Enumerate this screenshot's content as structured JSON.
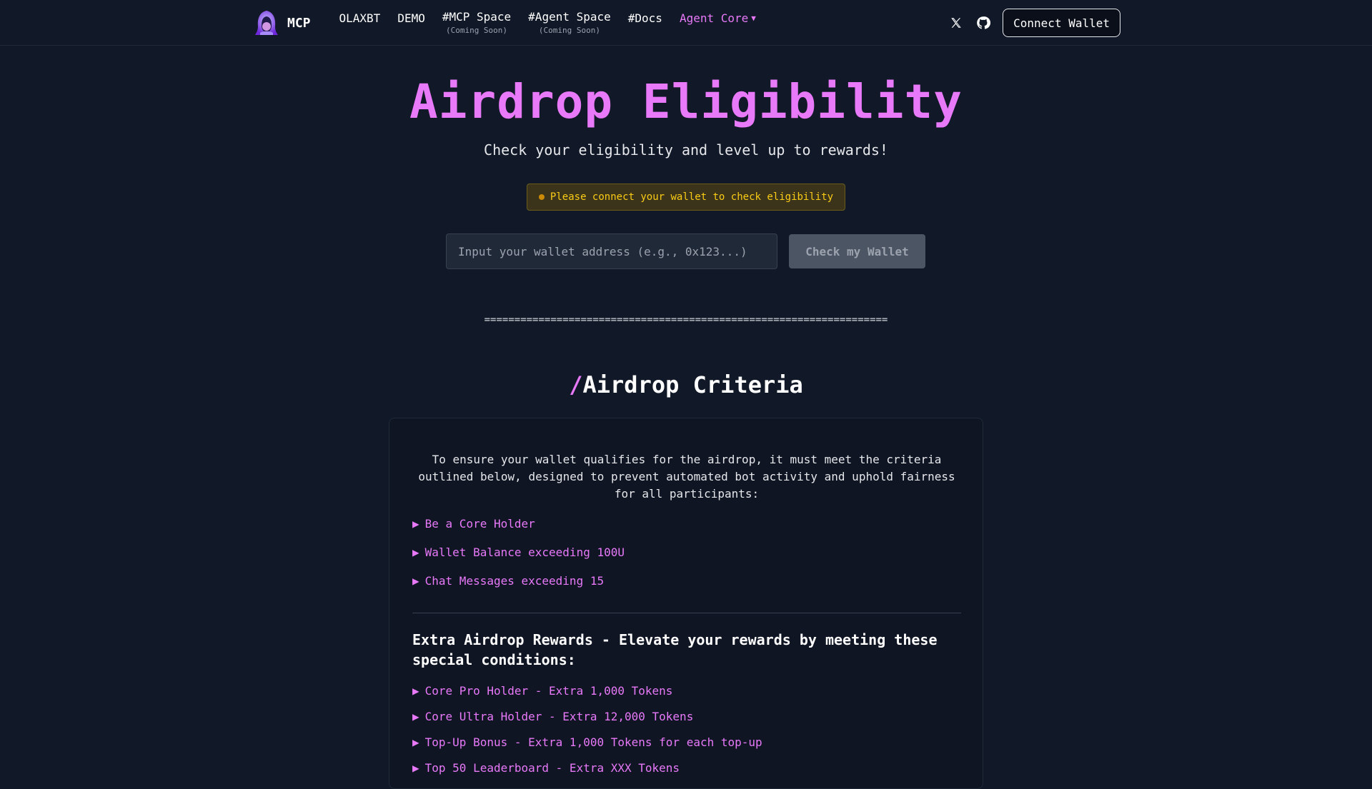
{
  "nav": {
    "brand": "MCP",
    "links": [
      {
        "label": "OLAXBT",
        "sub": ""
      },
      {
        "label": "DEMO",
        "sub": ""
      },
      {
        "label": "#MCP Space",
        "sub": "(Coming Soon)"
      },
      {
        "label": "#Agent Space",
        "sub": "(Coming Soon)"
      },
      {
        "label": "#Docs",
        "sub": ""
      }
    ],
    "dropdown_label": "Agent Core",
    "caret": "▼",
    "x_icon": "x-icon",
    "github_icon": "github-icon",
    "connect_label": "Connect Wallet"
  },
  "hero": {
    "title": "Airdrop Eligibility",
    "subtitle": "Check your eligibility and level up to rewards!",
    "notice": "Please connect your wallet to check eligibility",
    "input_placeholder": "Input your wallet address (e.g., 0x123...)",
    "input_value": "",
    "check_label": "Check my Wallet",
    "divider": "==================================================================="
  },
  "criteria": {
    "slash": "/",
    "title": "Airdrop Criteria",
    "intro": "To ensure your wallet qualifies for the airdrop, it must meet the criteria outlined below, designed to prevent automated bot activity and uphold fairness for all participants:",
    "arrow": "▶",
    "items": [
      "Be a Core Holder",
      "Wallet Balance exceeding 100U",
      "Chat Messages exceeding 15"
    ],
    "extra_title": "Extra Airdrop Rewards - Elevate your rewards by meeting these special conditions:",
    "extra_items": [
      "Core Pro Holder - Extra 1,000 Tokens",
      "Core Ultra Holder - Extra 12,000 Tokens",
      "Top-Up Bonus - Extra 1,000 Tokens for each top-up",
      "Top 50 Leaderboard - Extra XXX Tokens"
    ]
  },
  "colors": {
    "background": "#111827",
    "accent": "#e879f9",
    "notice_text": "#facc15",
    "notice_bg": "#3b341a"
  }
}
